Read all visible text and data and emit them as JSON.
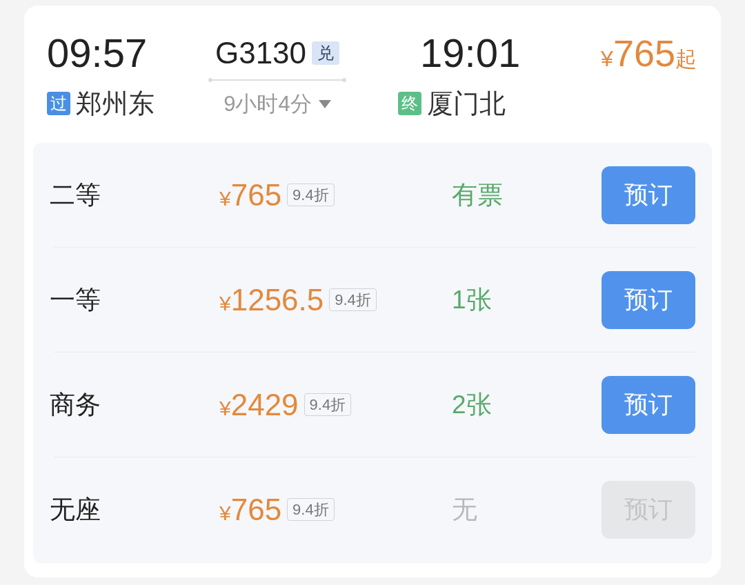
{
  "train": {
    "departure": {
      "time": "09:57",
      "tag": "过",
      "kind": "pass",
      "station": "郑州东"
    },
    "number": "G3130",
    "badge": "兑",
    "duration": "9小时4分",
    "arrival": {
      "time": "19:01",
      "tag": "终",
      "kind": "end",
      "station": "厦门北"
    },
    "price": {
      "currency": "¥",
      "amount": "765",
      "suffix": "起"
    }
  },
  "seats": [
    {
      "name": "二等",
      "currency": "¥",
      "price": "765",
      "discount": "9.4折",
      "availability": "有票",
      "available": true,
      "button": {
        "label": "预订",
        "disabled": false
      }
    },
    {
      "name": "一等",
      "currency": "¥",
      "price": "1256.5",
      "discount": "9.4折",
      "availability": "1张",
      "available": true,
      "button": {
        "label": "预订",
        "disabled": false
      }
    },
    {
      "name": "商务",
      "currency": "¥",
      "price": "2429",
      "discount": "9.4折",
      "availability": "2张",
      "available": true,
      "button": {
        "label": "预订",
        "disabled": false
      }
    },
    {
      "name": "无座",
      "currency": "¥",
      "price": "765",
      "discount": "9.4折",
      "availability": "无",
      "available": false,
      "button": {
        "label": "预订",
        "disabled": true
      }
    }
  ]
}
